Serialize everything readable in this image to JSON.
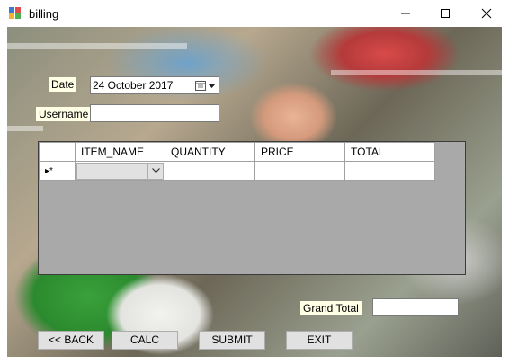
{
  "window": {
    "title": "billing"
  },
  "form": {
    "date_label": "Date",
    "date_value": "24  October  2017",
    "username_label": "Username",
    "username_value": "",
    "grand_total_label": "Grand Total",
    "grand_total_value": ""
  },
  "grid": {
    "columns": [
      "ITEM_NAME",
      "QUANTITY",
      "PRICE",
      "TOTAL"
    ],
    "new_row_marker": "▸*",
    "new_row": {
      "item_name": "",
      "quantity": "",
      "price": "",
      "total": ""
    }
  },
  "buttons": {
    "back": "<< BACK",
    "calc": "CALC",
    "submit": "SUBMIT",
    "exit": "EXIT"
  },
  "icons": {
    "app": "app-icon",
    "minimize": "minimize-icon",
    "maximize": "maximize-icon",
    "close": "close-icon",
    "calendar": "calendar-icon",
    "dropdown": "chevron-down-icon"
  }
}
